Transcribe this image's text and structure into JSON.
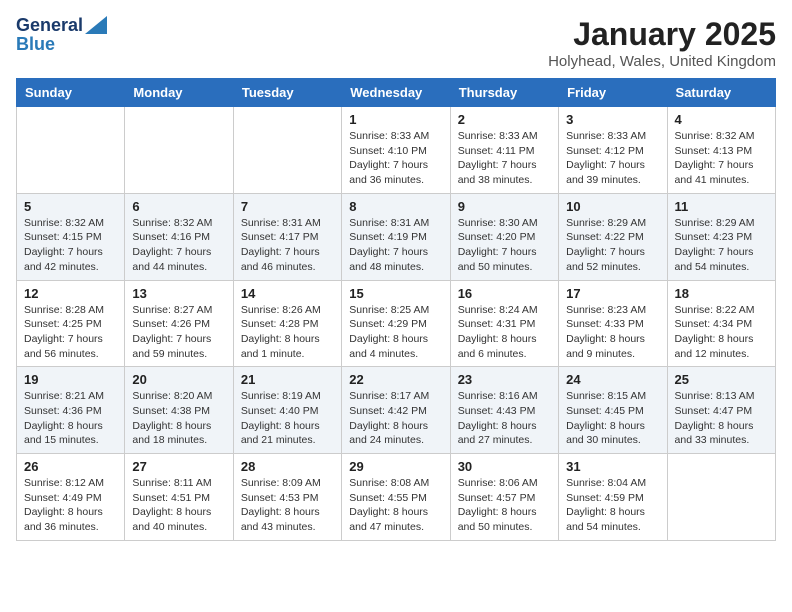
{
  "header": {
    "logo_line1": "General",
    "logo_line2": "Blue",
    "month": "January 2025",
    "location": "Holyhead, Wales, United Kingdom"
  },
  "weekdays": [
    "Sunday",
    "Monday",
    "Tuesday",
    "Wednesday",
    "Thursday",
    "Friday",
    "Saturday"
  ],
  "weeks": [
    [
      {
        "day": "",
        "info": ""
      },
      {
        "day": "",
        "info": ""
      },
      {
        "day": "",
        "info": ""
      },
      {
        "day": "1",
        "info": "Sunrise: 8:33 AM\nSunset: 4:10 PM\nDaylight: 7 hours\nand 36 minutes."
      },
      {
        "day": "2",
        "info": "Sunrise: 8:33 AM\nSunset: 4:11 PM\nDaylight: 7 hours\nand 38 minutes."
      },
      {
        "day": "3",
        "info": "Sunrise: 8:33 AM\nSunset: 4:12 PM\nDaylight: 7 hours\nand 39 minutes."
      },
      {
        "day": "4",
        "info": "Sunrise: 8:32 AM\nSunset: 4:13 PM\nDaylight: 7 hours\nand 41 minutes."
      }
    ],
    [
      {
        "day": "5",
        "info": "Sunrise: 8:32 AM\nSunset: 4:15 PM\nDaylight: 7 hours\nand 42 minutes."
      },
      {
        "day": "6",
        "info": "Sunrise: 8:32 AM\nSunset: 4:16 PM\nDaylight: 7 hours\nand 44 minutes."
      },
      {
        "day": "7",
        "info": "Sunrise: 8:31 AM\nSunset: 4:17 PM\nDaylight: 7 hours\nand 46 minutes."
      },
      {
        "day": "8",
        "info": "Sunrise: 8:31 AM\nSunset: 4:19 PM\nDaylight: 7 hours\nand 48 minutes."
      },
      {
        "day": "9",
        "info": "Sunrise: 8:30 AM\nSunset: 4:20 PM\nDaylight: 7 hours\nand 50 minutes."
      },
      {
        "day": "10",
        "info": "Sunrise: 8:29 AM\nSunset: 4:22 PM\nDaylight: 7 hours\nand 52 minutes."
      },
      {
        "day": "11",
        "info": "Sunrise: 8:29 AM\nSunset: 4:23 PM\nDaylight: 7 hours\nand 54 minutes."
      }
    ],
    [
      {
        "day": "12",
        "info": "Sunrise: 8:28 AM\nSunset: 4:25 PM\nDaylight: 7 hours\nand 56 minutes."
      },
      {
        "day": "13",
        "info": "Sunrise: 8:27 AM\nSunset: 4:26 PM\nDaylight: 7 hours\nand 59 minutes."
      },
      {
        "day": "14",
        "info": "Sunrise: 8:26 AM\nSunset: 4:28 PM\nDaylight: 8 hours\nand 1 minute."
      },
      {
        "day": "15",
        "info": "Sunrise: 8:25 AM\nSunset: 4:29 PM\nDaylight: 8 hours\nand 4 minutes."
      },
      {
        "day": "16",
        "info": "Sunrise: 8:24 AM\nSunset: 4:31 PM\nDaylight: 8 hours\nand 6 minutes."
      },
      {
        "day": "17",
        "info": "Sunrise: 8:23 AM\nSunset: 4:33 PM\nDaylight: 8 hours\nand 9 minutes."
      },
      {
        "day": "18",
        "info": "Sunrise: 8:22 AM\nSunset: 4:34 PM\nDaylight: 8 hours\nand 12 minutes."
      }
    ],
    [
      {
        "day": "19",
        "info": "Sunrise: 8:21 AM\nSunset: 4:36 PM\nDaylight: 8 hours\nand 15 minutes."
      },
      {
        "day": "20",
        "info": "Sunrise: 8:20 AM\nSunset: 4:38 PM\nDaylight: 8 hours\nand 18 minutes."
      },
      {
        "day": "21",
        "info": "Sunrise: 8:19 AM\nSunset: 4:40 PM\nDaylight: 8 hours\nand 21 minutes."
      },
      {
        "day": "22",
        "info": "Sunrise: 8:17 AM\nSunset: 4:42 PM\nDaylight: 8 hours\nand 24 minutes."
      },
      {
        "day": "23",
        "info": "Sunrise: 8:16 AM\nSunset: 4:43 PM\nDaylight: 8 hours\nand 27 minutes."
      },
      {
        "day": "24",
        "info": "Sunrise: 8:15 AM\nSunset: 4:45 PM\nDaylight: 8 hours\nand 30 minutes."
      },
      {
        "day": "25",
        "info": "Sunrise: 8:13 AM\nSunset: 4:47 PM\nDaylight: 8 hours\nand 33 minutes."
      }
    ],
    [
      {
        "day": "26",
        "info": "Sunrise: 8:12 AM\nSunset: 4:49 PM\nDaylight: 8 hours\nand 36 minutes."
      },
      {
        "day": "27",
        "info": "Sunrise: 8:11 AM\nSunset: 4:51 PM\nDaylight: 8 hours\nand 40 minutes."
      },
      {
        "day": "28",
        "info": "Sunrise: 8:09 AM\nSunset: 4:53 PM\nDaylight: 8 hours\nand 43 minutes."
      },
      {
        "day": "29",
        "info": "Sunrise: 8:08 AM\nSunset: 4:55 PM\nDaylight: 8 hours\nand 47 minutes."
      },
      {
        "day": "30",
        "info": "Sunrise: 8:06 AM\nSunset: 4:57 PM\nDaylight: 8 hours\nand 50 minutes."
      },
      {
        "day": "31",
        "info": "Sunrise: 8:04 AM\nSunset: 4:59 PM\nDaylight: 8 hours\nand 54 minutes."
      },
      {
        "day": "",
        "info": ""
      }
    ]
  ]
}
